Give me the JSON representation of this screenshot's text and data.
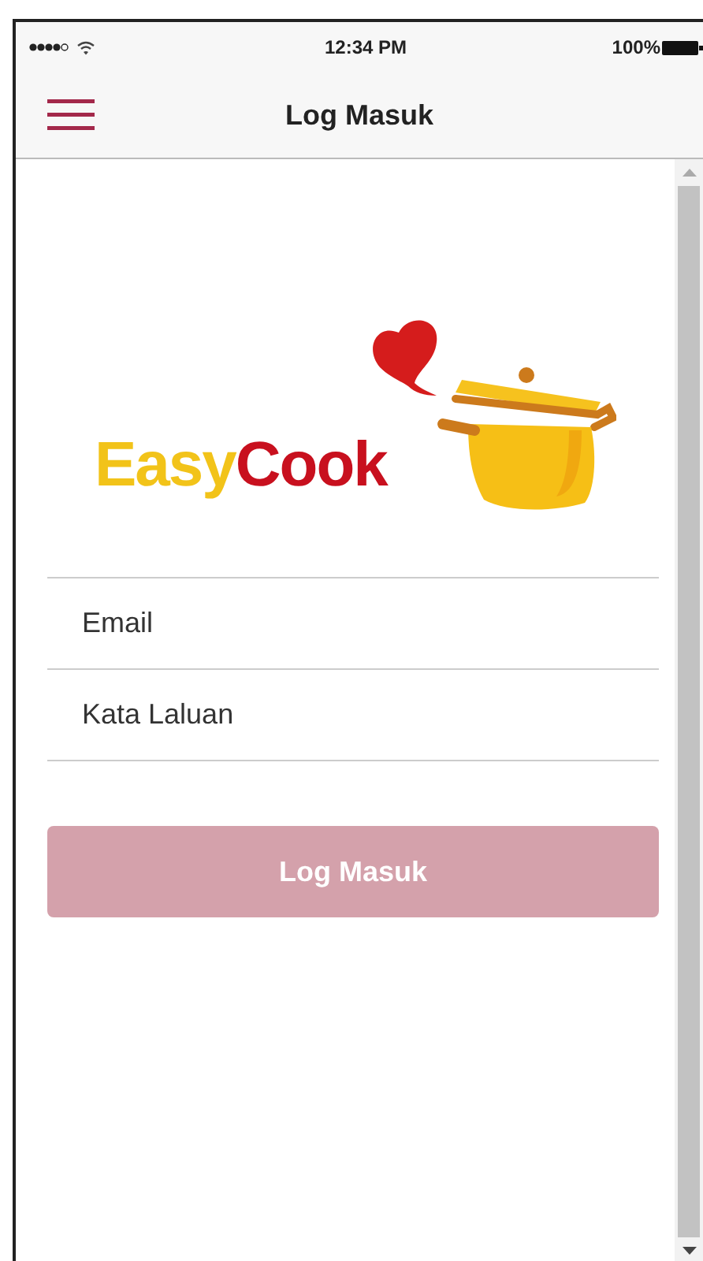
{
  "status_bar": {
    "time": "12:34 PM",
    "battery": "100%"
  },
  "nav": {
    "title": "Log Masuk"
  },
  "logo": {
    "parts": [
      {
        "text": "Easy",
        "color": "#f2c319"
      },
      {
        "text": "Cook",
        "color": "#c8101e"
      }
    ]
  },
  "fields": [
    {
      "placeholder": "Email"
    },
    {
      "placeholder": "Kata Laluan"
    }
  ],
  "login_button": {
    "label": "Log Masuk",
    "disabled": true
  }
}
